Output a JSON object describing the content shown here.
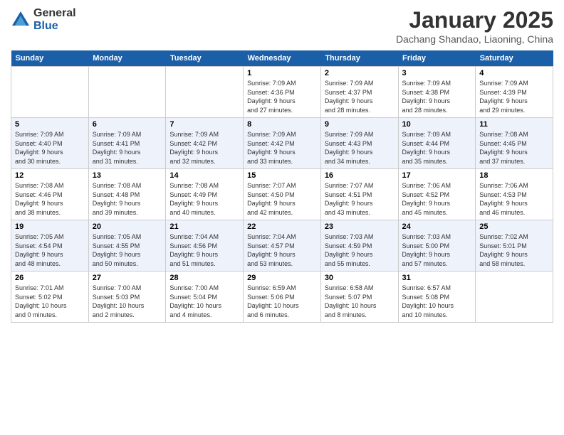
{
  "logo": {
    "general": "General",
    "blue": "Blue"
  },
  "title": "January 2025",
  "location": "Dachang Shandao, Liaoning, China",
  "days_of_week": [
    "Sunday",
    "Monday",
    "Tuesday",
    "Wednesday",
    "Thursday",
    "Friday",
    "Saturday"
  ],
  "weeks": [
    [
      {
        "num": "",
        "info": ""
      },
      {
        "num": "",
        "info": ""
      },
      {
        "num": "",
        "info": ""
      },
      {
        "num": "1",
        "info": "Sunrise: 7:09 AM\nSunset: 4:36 PM\nDaylight: 9 hours\nand 27 minutes."
      },
      {
        "num": "2",
        "info": "Sunrise: 7:09 AM\nSunset: 4:37 PM\nDaylight: 9 hours\nand 28 minutes."
      },
      {
        "num": "3",
        "info": "Sunrise: 7:09 AM\nSunset: 4:38 PM\nDaylight: 9 hours\nand 28 minutes."
      },
      {
        "num": "4",
        "info": "Sunrise: 7:09 AM\nSunset: 4:39 PM\nDaylight: 9 hours\nand 29 minutes."
      }
    ],
    [
      {
        "num": "5",
        "info": "Sunrise: 7:09 AM\nSunset: 4:40 PM\nDaylight: 9 hours\nand 30 minutes."
      },
      {
        "num": "6",
        "info": "Sunrise: 7:09 AM\nSunset: 4:41 PM\nDaylight: 9 hours\nand 31 minutes."
      },
      {
        "num": "7",
        "info": "Sunrise: 7:09 AM\nSunset: 4:42 PM\nDaylight: 9 hours\nand 32 minutes."
      },
      {
        "num": "8",
        "info": "Sunrise: 7:09 AM\nSunset: 4:42 PM\nDaylight: 9 hours\nand 33 minutes."
      },
      {
        "num": "9",
        "info": "Sunrise: 7:09 AM\nSunset: 4:43 PM\nDaylight: 9 hours\nand 34 minutes."
      },
      {
        "num": "10",
        "info": "Sunrise: 7:09 AM\nSunset: 4:44 PM\nDaylight: 9 hours\nand 35 minutes."
      },
      {
        "num": "11",
        "info": "Sunrise: 7:08 AM\nSunset: 4:45 PM\nDaylight: 9 hours\nand 37 minutes."
      }
    ],
    [
      {
        "num": "12",
        "info": "Sunrise: 7:08 AM\nSunset: 4:46 PM\nDaylight: 9 hours\nand 38 minutes."
      },
      {
        "num": "13",
        "info": "Sunrise: 7:08 AM\nSunset: 4:48 PM\nDaylight: 9 hours\nand 39 minutes."
      },
      {
        "num": "14",
        "info": "Sunrise: 7:08 AM\nSunset: 4:49 PM\nDaylight: 9 hours\nand 40 minutes."
      },
      {
        "num": "15",
        "info": "Sunrise: 7:07 AM\nSunset: 4:50 PM\nDaylight: 9 hours\nand 42 minutes."
      },
      {
        "num": "16",
        "info": "Sunrise: 7:07 AM\nSunset: 4:51 PM\nDaylight: 9 hours\nand 43 minutes."
      },
      {
        "num": "17",
        "info": "Sunrise: 7:06 AM\nSunset: 4:52 PM\nDaylight: 9 hours\nand 45 minutes."
      },
      {
        "num": "18",
        "info": "Sunrise: 7:06 AM\nSunset: 4:53 PM\nDaylight: 9 hours\nand 46 minutes."
      }
    ],
    [
      {
        "num": "19",
        "info": "Sunrise: 7:05 AM\nSunset: 4:54 PM\nDaylight: 9 hours\nand 48 minutes."
      },
      {
        "num": "20",
        "info": "Sunrise: 7:05 AM\nSunset: 4:55 PM\nDaylight: 9 hours\nand 50 minutes."
      },
      {
        "num": "21",
        "info": "Sunrise: 7:04 AM\nSunset: 4:56 PM\nDaylight: 9 hours\nand 51 minutes."
      },
      {
        "num": "22",
        "info": "Sunrise: 7:04 AM\nSunset: 4:57 PM\nDaylight: 9 hours\nand 53 minutes."
      },
      {
        "num": "23",
        "info": "Sunrise: 7:03 AM\nSunset: 4:59 PM\nDaylight: 9 hours\nand 55 minutes."
      },
      {
        "num": "24",
        "info": "Sunrise: 7:03 AM\nSunset: 5:00 PM\nDaylight: 9 hours\nand 57 minutes."
      },
      {
        "num": "25",
        "info": "Sunrise: 7:02 AM\nSunset: 5:01 PM\nDaylight: 9 hours\nand 58 minutes."
      }
    ],
    [
      {
        "num": "26",
        "info": "Sunrise: 7:01 AM\nSunset: 5:02 PM\nDaylight: 10 hours\nand 0 minutes."
      },
      {
        "num": "27",
        "info": "Sunrise: 7:00 AM\nSunset: 5:03 PM\nDaylight: 10 hours\nand 2 minutes."
      },
      {
        "num": "28",
        "info": "Sunrise: 7:00 AM\nSunset: 5:04 PM\nDaylight: 10 hours\nand 4 minutes."
      },
      {
        "num": "29",
        "info": "Sunrise: 6:59 AM\nSunset: 5:06 PM\nDaylight: 10 hours\nand 6 minutes."
      },
      {
        "num": "30",
        "info": "Sunrise: 6:58 AM\nSunset: 5:07 PM\nDaylight: 10 hours\nand 8 minutes."
      },
      {
        "num": "31",
        "info": "Sunrise: 6:57 AM\nSunset: 5:08 PM\nDaylight: 10 hours\nand 10 minutes."
      },
      {
        "num": "",
        "info": ""
      }
    ]
  ]
}
